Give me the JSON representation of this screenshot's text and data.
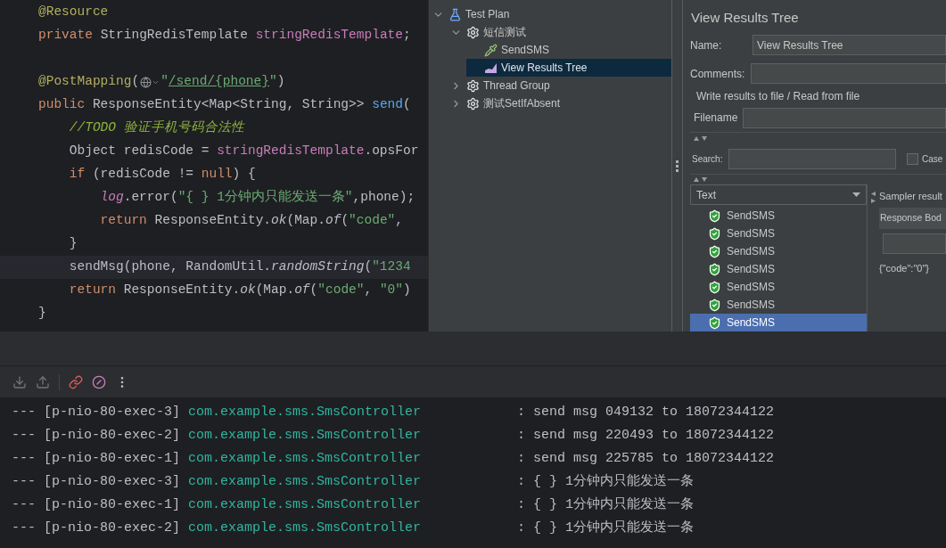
{
  "editor": {
    "lines": [
      {
        "current": false,
        "tokens": [
          {
            "kind": "annotation",
            "text": "@Resource"
          }
        ]
      },
      {
        "current": false,
        "tokens": [
          {
            "kind": "keyword",
            "text": "private "
          },
          {
            "kind": "plain",
            "text": "StringRedisTemplate "
          },
          {
            "kind": "field",
            "text": "stringRedisTemplate"
          },
          {
            "kind": "plain",
            "text": ";"
          }
        ]
      },
      {
        "current": false
      },
      {
        "current": false,
        "tokens": [
          {
            "kind": "annotation",
            "text": "@PostMapping"
          },
          {
            "kind": "plain",
            "text": "("
          },
          {
            "kind": "web_icon"
          },
          {
            "kind": "string",
            "text": "\""
          },
          {
            "kind": "link",
            "text": "/send/{phone}"
          },
          {
            "kind": "string",
            "text": "\""
          },
          {
            "kind": "plain",
            "text": ")"
          }
        ]
      },
      {
        "current": false,
        "tokens": [
          {
            "kind": "keyword",
            "text": "public "
          },
          {
            "kind": "plain",
            "text": "ResponseEntity<Map<String, String>> "
          },
          {
            "kind": "decl",
            "text": "send"
          },
          {
            "kind": "plain",
            "text": "("
          }
        ]
      },
      {
        "current": false,
        "tokens": [
          {
            "kind": "todo",
            "text": "    //TODO 验证手机号码合法性"
          }
        ]
      },
      {
        "current": false,
        "tokens": [
          {
            "kind": "plain",
            "text": "    Object redisCode = "
          },
          {
            "kind": "field",
            "text": "stringRedisTemplate"
          },
          {
            "kind": "plain",
            "text": ".opsFor"
          }
        ]
      },
      {
        "current": false,
        "tokens": [
          {
            "kind": "keyword",
            "text": "    if "
          },
          {
            "kind": "plain",
            "text": "(redisCode != "
          },
          {
            "kind": "keyword",
            "text": "null"
          },
          {
            "kind": "plain",
            "text": ") {"
          }
        ]
      },
      {
        "current": false,
        "tokens": [
          {
            "kind": "static_field",
            "text": "        log"
          },
          {
            "kind": "plain",
            "text": ".error("
          },
          {
            "kind": "string",
            "text": "\"{ } 1分钟内只能发送一条\""
          },
          {
            "kind": "plain",
            "text": ",phone);"
          }
        ]
      },
      {
        "current": false,
        "tokens": [
          {
            "kind": "keyword",
            "text": "        return "
          },
          {
            "kind": "plain",
            "text": "ResponseEntity."
          },
          {
            "kind": "italic",
            "text": "ok"
          },
          {
            "kind": "plain",
            "text": "(Map."
          },
          {
            "kind": "italic",
            "text": "of"
          },
          {
            "kind": "plain",
            "text": "("
          },
          {
            "kind": "string",
            "text": "\"code\""
          },
          {
            "kind": "plain",
            "text": ","
          }
        ]
      },
      {
        "current": false,
        "tokens": [
          {
            "kind": "plain",
            "text": "    }"
          }
        ]
      },
      {
        "current": true,
        "tokens": [
          {
            "kind": "plain",
            "text": "    sendMsg(phone, RandomUtil."
          },
          {
            "kind": "italic",
            "text": "randomString"
          },
          {
            "kind": "plain",
            "text": "("
          },
          {
            "kind": "string",
            "text": "\"1234"
          }
        ]
      },
      {
        "current": false,
        "tokens": [
          {
            "kind": "keyword",
            "text": "    return "
          },
          {
            "kind": "plain",
            "text": "ResponseEntity."
          },
          {
            "kind": "italic",
            "text": "ok"
          },
          {
            "kind": "plain",
            "text": "(Map."
          },
          {
            "kind": "italic",
            "text": "of"
          },
          {
            "kind": "plain",
            "text": "("
          },
          {
            "kind": "string",
            "text": "\"code\""
          },
          {
            "kind": "plain",
            "text": ", "
          },
          {
            "kind": "string",
            "text": "\"0\""
          },
          {
            "kind": "plain",
            "text": ")"
          }
        ]
      },
      {
        "current": false,
        "tokens": [
          {
            "kind": "plain",
            "text": "}"
          }
        ]
      }
    ]
  },
  "jmeter": {
    "tree": [
      {
        "label": "Test Plan",
        "kind": "plan",
        "expanded": true,
        "selected": false,
        "children": [
          {
            "label": "短信测试",
            "kind": "group",
            "expanded": true,
            "selected": false,
            "children": [
              {
                "label": "SendSMS",
                "kind": "sampler",
                "selected": false
              },
              {
                "label": "View Results Tree",
                "kind": "listener",
                "selected": true
              }
            ]
          },
          {
            "label": "Thread Group",
            "kind": "group",
            "expanded": false,
            "selected": false
          },
          {
            "label": "测试SetIfAbsent",
            "kind": "group",
            "expanded": false,
            "selected": false
          }
        ]
      }
    ],
    "panel": {
      "title": "View Results Tree",
      "name_label": "Name:",
      "name_value": "View Results Tree",
      "comments_label": "Comments:",
      "file_section": "Write results to file / Read from file",
      "filename_label": "Filename",
      "search_label": "Search:",
      "case_label": "Case",
      "case_checked": false,
      "renderer": "Text",
      "results": [
        {
          "label": "SendSMS",
          "selected": false
        },
        {
          "label": "SendSMS",
          "selected": false
        },
        {
          "label": "SendSMS",
          "selected": false
        },
        {
          "label": "SendSMS",
          "selected": false
        },
        {
          "label": "SendSMS",
          "selected": false
        },
        {
          "label": "SendSMS",
          "selected": false
        },
        {
          "label": "SendSMS",
          "selected": true
        }
      ],
      "sampler_tab": "Sampler result",
      "response_tab": "Response Bod",
      "response_body": "{\"code\":\"0\"}"
    }
  },
  "console": {
    "lines": [
      {
        "thread": "--- [p-nio-80-exec-3]",
        "logger": "com.example.sms.SmsController",
        "message": ": send msg 049132 to 18072344122"
      },
      {
        "thread": "--- [p-nio-80-exec-2]",
        "logger": "com.example.sms.SmsController",
        "message": ": send msg 220493 to 18072344122"
      },
      {
        "thread": "--- [p-nio-80-exec-1]",
        "logger": "com.example.sms.SmsController",
        "message": ": send msg 225785 to 18072344122"
      },
      {
        "thread": "--- [p-nio-80-exec-3]",
        "logger": "com.example.sms.SmsController",
        "message": ": { } 1分钟内只能发送一条"
      },
      {
        "thread": "--- [p-nio-80-exec-1]",
        "logger": "com.example.sms.SmsController",
        "message": ": { } 1分钟内只能发送一条"
      },
      {
        "thread": "--- [p-nio-80-exec-2]",
        "logger": "com.example.sms.SmsController",
        "message": ": { } 1分钟内只能发送一条"
      }
    ]
  }
}
